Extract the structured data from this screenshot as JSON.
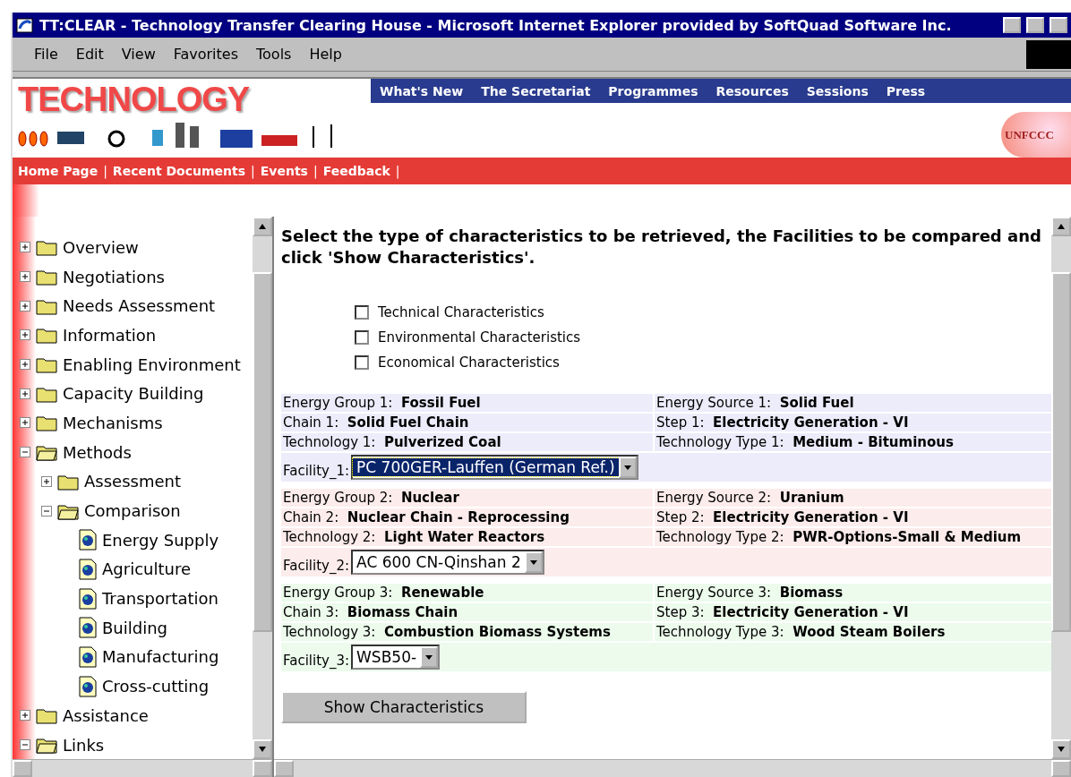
{
  "window": {
    "title": "TT:CLEAR - Technology Transfer Clearing House - Microsoft Internet Explorer provided by SoftQuad Software Inc."
  },
  "menu": [
    "File",
    "Edit",
    "View",
    "Favorites",
    "Tools",
    "Help"
  ],
  "header": {
    "logo": "TECHNOLOGY",
    "badge": "UNFCCC",
    "nav": [
      "What's New",
      "The Secretariat",
      "Programmes",
      "Resources",
      "Sessions",
      "Press"
    ],
    "subnav": [
      "Home Page",
      "Recent Documents",
      "Events",
      "Feedback"
    ],
    "separator": "|"
  },
  "tree": [
    {
      "label": "Overview",
      "kind": "folder",
      "expanded": false
    },
    {
      "label": "Negotiations",
      "kind": "folder",
      "expanded": false
    },
    {
      "label": "Needs Assessment",
      "kind": "folder",
      "expanded": false
    },
    {
      "label": "Information",
      "kind": "folder",
      "expanded": false
    },
    {
      "label": "Enabling Environment",
      "kind": "folder",
      "expanded": false
    },
    {
      "label": "Capacity Building",
      "kind": "folder",
      "expanded": false
    },
    {
      "label": "Mechanisms",
      "kind": "folder",
      "expanded": false
    },
    {
      "label": "Methods",
      "kind": "folder",
      "expanded": true,
      "children": [
        {
          "label": "Assessment",
          "kind": "folder",
          "expanded": false
        },
        {
          "label": "Comparison",
          "kind": "folder",
          "expanded": true,
          "children": [
            {
              "label": "Energy Supply",
              "kind": "page"
            },
            {
              "label": "Agriculture",
              "kind": "page"
            },
            {
              "label": "Transportation",
              "kind": "page"
            },
            {
              "label": "Building",
              "kind": "page"
            },
            {
              "label": "Manufacturing",
              "kind": "page"
            },
            {
              "label": "Cross-cutting",
              "kind": "page"
            }
          ]
        }
      ]
    },
    {
      "label": "Assistance",
      "kind": "folder",
      "expanded": false
    },
    {
      "label": "Links",
      "kind": "folder",
      "expanded": true
    }
  ],
  "instruction": "Select the type of characteristics to be retrieved, the Facilities to be compared and click 'Show Characteristics'.",
  "options": [
    {
      "label": "Technical Characteristics",
      "checked": false
    },
    {
      "label": "Environmental Characteristics",
      "checked": false
    },
    {
      "label": "Economical Characteristics",
      "checked": false
    }
  ],
  "groups": [
    {
      "color": "#ececfb",
      "rows": [
        [
          "Energy Group 1:",
          "Fossil Fuel",
          "Energy Source 1:",
          "Solid Fuel"
        ],
        [
          "Chain 1:",
          "Solid Fuel Chain",
          "Step 1:",
          "Electricity Generation - VI"
        ],
        [
          "Technology 1:",
          "Pulverized Coal",
          "Technology Type 1:",
          "Medium - Bituminous"
        ]
      ],
      "facility_label": "Facility_1:",
      "facility": "PC 700GER-Lauffen (German Ref.)",
      "focused": true
    },
    {
      "color": "#fdecec",
      "rows": [
        [
          "Energy Group 2:",
          "Nuclear",
          "Energy Source 2:",
          "Uranium"
        ],
        [
          "Chain 2:",
          "Nuclear Chain - Reprocessing",
          "Step 2:",
          "Electricity Generation - VI"
        ],
        [
          "Technology 2:",
          "Light Water Reactors",
          "Technology Type 2:",
          "PWR-Options-Small & Medium"
        ]
      ],
      "facility_label": "Facility_2:",
      "facility": "AC 600 CN-Qinshan 2",
      "focused": false
    },
    {
      "color": "#ecfbec",
      "rows": [
        [
          "Energy Group 3:",
          "Renewable",
          "Energy Source 3:",
          "Biomass"
        ],
        [
          "Chain 3:",
          "Biomass Chain",
          "Step 3:",
          "Electricity Generation - VI"
        ],
        [
          "Technology 3:",
          "Combustion Biomass Systems",
          "Technology Type 3:",
          "Wood Steam Boilers"
        ]
      ],
      "facility_label": "Facility_3:",
      "facility": "WSB50-",
      "focused": false
    }
  ],
  "submit": "Show Characteristics"
}
